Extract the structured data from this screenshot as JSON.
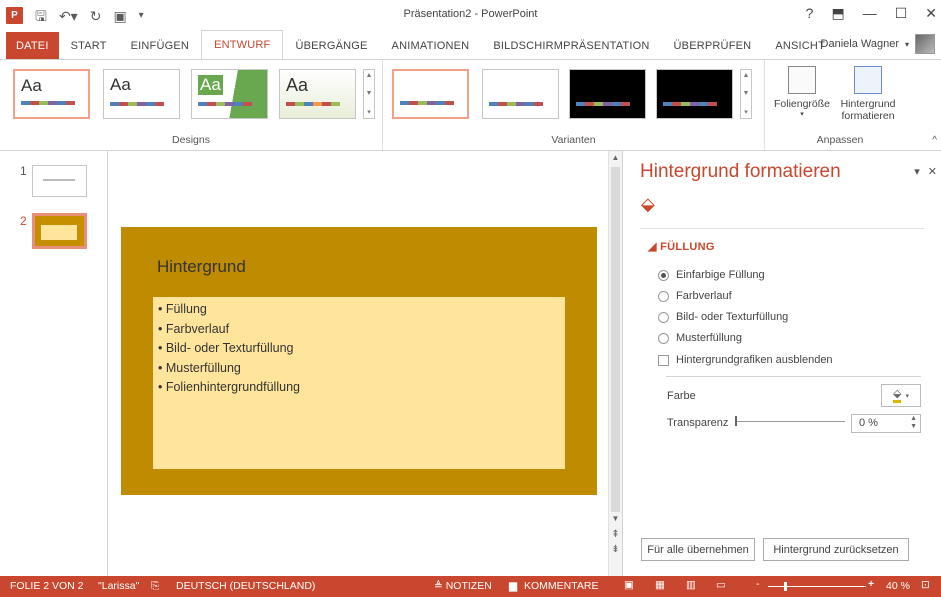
{
  "titlebar": {
    "app_logo": "P",
    "title": "Präsentation2 - PowerPoint",
    "help": "?",
    "ribbon_display": "⬒",
    "minimize": "—",
    "maximize": "☐",
    "close": "✕"
  },
  "tabs": [
    {
      "label": "DATEI"
    },
    {
      "label": "START"
    },
    {
      "label": "EINFÜGEN"
    },
    {
      "label": "ENTWURF"
    },
    {
      "label": "ÜBERGÄNGE"
    },
    {
      "label": "ANIMATIONEN"
    },
    {
      "label": "BILDSCHIRMPRÄSENTATION"
    },
    {
      "label": "ÜBERPRÜFEN"
    },
    {
      "label": "ANSICHT"
    }
  ],
  "user": {
    "name": "Daniela Wagner"
  },
  "ribbon": {
    "designs_label": "Designs",
    "varianten_label": "Varianten",
    "anpassen_label": "Anpassen",
    "theme_aa": "Aa",
    "foliengroesse": "Foliengröße",
    "hintergrund": "Hintergrund",
    "formatieren": "formatieren",
    "collapse": "^"
  },
  "thumbs": [
    {
      "num": "1"
    },
    {
      "num": "2"
    }
  ],
  "slide": {
    "title": "Hintergrund",
    "bullets": [
      "• Füllung",
      "• Farbverlauf",
      "• Bild- oder Texturfüllung",
      "• Musterfüllung",
      "• Folienhintergrundfüllung"
    ]
  },
  "pane": {
    "title": "Hintergrund formatieren",
    "section": "◢ FÜLLUNG",
    "radios": [
      {
        "label": "Einfarbige Füllung",
        "checked": true
      },
      {
        "label": "Farbverlauf",
        "checked": false
      },
      {
        "label": "Bild- oder Texturfüllung",
        "checked": false
      },
      {
        "label": "Musterfüllung",
        "checked": false
      }
    ],
    "checkbox_label": "Hintergrundgrafiken ausblenden",
    "farbe_label": "Farbe",
    "transparenz_label": "Transparenz",
    "transparenz_value": "0 %",
    "apply_all": "Für alle übernehmen",
    "reset": "Hintergrund zurücksetzen"
  },
  "statusbar": {
    "slide_info": "FOLIE 2 VON 2",
    "theme": "\"Larissa\"",
    "language": "DEUTSCH (DEUTSCHLAND)",
    "notes": "≜ NOTIZEN",
    "comments": "KOMMENTARE",
    "zoom": "40 %",
    "zoom_minus": "-",
    "zoom_plus": "+"
  },
  "colors": {
    "accent": "#c9472e",
    "slide_bg": "#bf8b00",
    "content_bg": "#ffe59b"
  }
}
